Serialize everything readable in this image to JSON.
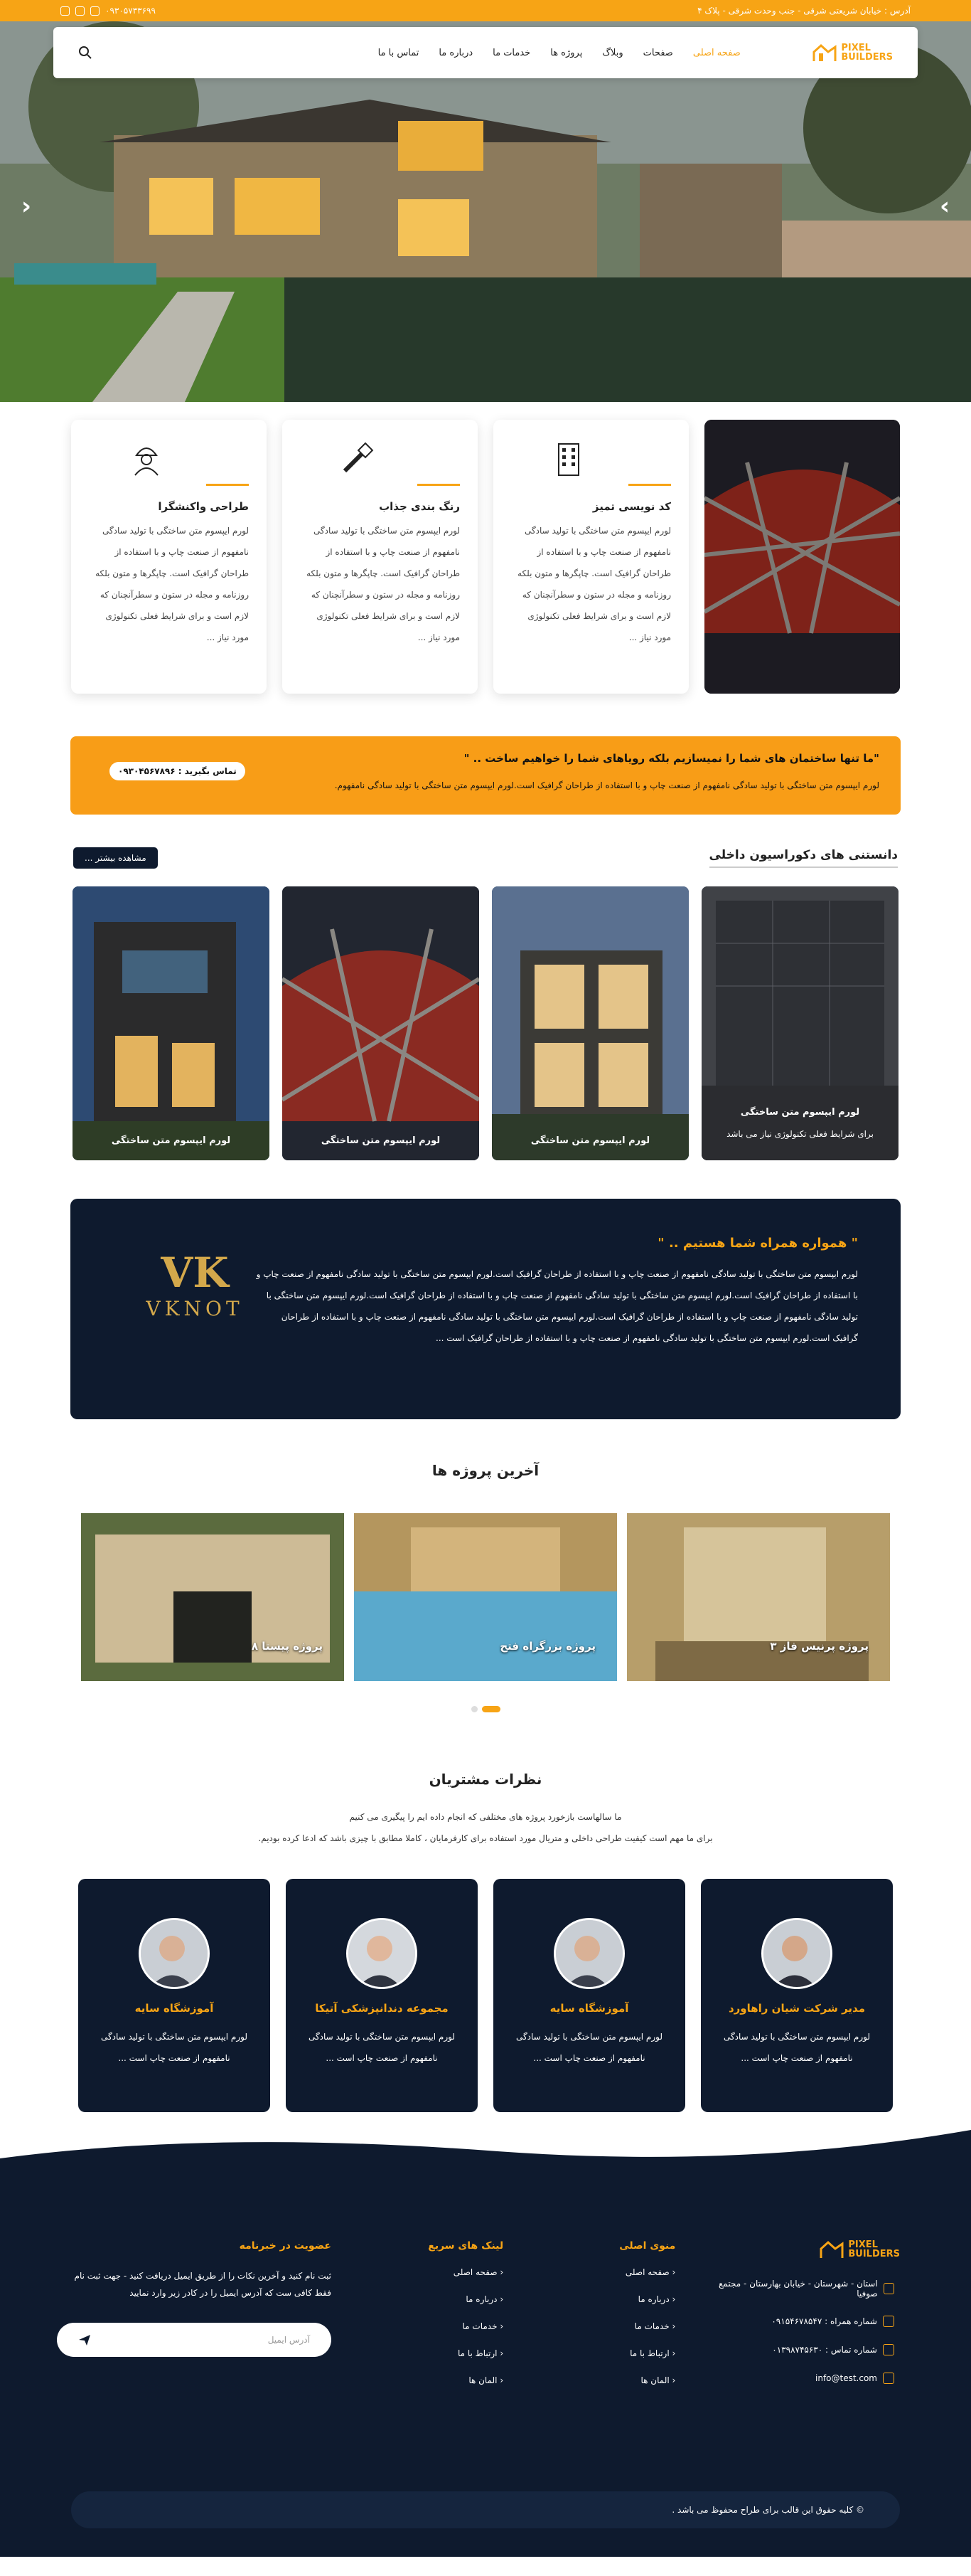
{
  "topbar": {
    "address": "آدرس : خیابان شریعتی شرقی - جنب وحدت شرقی - پلاک ۴",
    "phone": "۰۹۳۰۵۷۳۳۶۹۹",
    "social_icons": [
      "whatsapp-icon",
      "telegram-icon",
      "instagram-icon"
    ]
  },
  "nav": {
    "logo_line1": "PIXEL",
    "logo_line2": "BUILDERS",
    "items": [
      "صفحه اصلی",
      "صفحات",
      "وبلاگ",
      "پروژه ها",
      "خدمات ما",
      "درباره ما",
      "تماس با ما"
    ],
    "active": "صفحه اصلی"
  },
  "features": [
    {
      "title": "کد نویسی تمیز",
      "icon": "building-icon",
      "text": "لورم ایپسوم متن ساختگی با تولید سادگی نامفهوم از صنعت چاپ و با استفاده از طراحان گرافیک است. چاپگرها و متون بلکه روزنامه و مجله در ستون و سطرآنچنان که لازم است و برای شرایط فعلی تکنولوژی مورد نیاز ..."
    },
    {
      "title": "رنگ بندی جذاب",
      "icon": "paint-brush-icon",
      "text": "لورم ایپسوم متن ساختگی با تولید سادگی نامفهوم از صنعت چاپ و با استفاده از طراحان گرافیک است. چاپگرها و متون بلکه روزنامه و مجله در ستون و سطرآنچنان که لازم است و برای شرایط فعلی تکنولوژی مورد نیاز ..."
    },
    {
      "title": "طراحی واکنشگرا",
      "icon": "engineer-icon",
      "text": "لورم ایپسوم متن ساختگی با تولید سادگی نامفهوم از صنعت چاپ و با استفاده از طراحان گرافیک است. چاپگرها و متون بلکه روزنامه و مجله در ستون و سطرآنچنان که لازم است و برای شرایط فعلی تکنولوژی مورد نیاز ..."
    }
  ],
  "cta": {
    "title": "\"ما تنها ساختمان های شما را نمیسازیم بلکه رویاهای شما را خواهیم ساخت .. \"",
    "text": "لورم ایپسوم متن ساختگی با تولید سادگی نامفهوم از صنعت چاپ و با استفاده از طراحان گرافیک است.لورم ایپسوم متن ساختگی با تولید سادگی نامفهوم.",
    "button": "تماس بگیرید : ۰۹۳۰۴۵۶۷۸۹۶"
  },
  "knowledge": {
    "title": "دانستنی های دکوراسیون داخلی",
    "more": "مشاهده بیشتر ...",
    "cards": [
      {
        "caption": "لورم ایپسوم متن ساختگی",
        "sub": "برای شرایط فعلی تکنولوژی نیاز می باشد"
      },
      {
        "caption": "لورم ایپسوم متن ساختگی",
        "sub": ""
      },
      {
        "caption": "لورم ایپسوم متن ساختگی",
        "sub": ""
      },
      {
        "caption": "لورم ایپسوم متن ساختگی",
        "sub": ""
      }
    ]
  },
  "banner": {
    "title": "\" همواره همراه شما هستیم .. \"",
    "text": "لورم ایپسوم متن ساختگی با تولید سادگی نامفهوم از صنعت چاپ و با استفاده از طراحان گرافیک است.لورم ایپسوم متن ساختگی با تولید سادگی نامفهوم از صنعت چاپ و با استفاده از طراحان گرافیک است.لورم ایپسوم متن ساختگی با تولید سادگی نامفهوم از صنعت چاپ و با استفاده از طراحان گرافیک است.لورم ایپسوم متن ساختگی با تولید سادگی نامفهوم از صنعت چاپ و با استفاده از طراحان گرافیک است.لورم ایپسوم متن ساختگی با تولید سادگی نامفهوم از صنعت چاپ و با استفاده از طراحان گرافیک است.لورم ایپسوم متن ساختگی با تولید سادگی نامفهوم از صنعت چاپ و با استفاده از طراحان گرافیک است ...",
    "logo_mono": "VK",
    "logo_word": "VKNOT"
  },
  "projects": {
    "title": "آخرین پروژه ها",
    "items": [
      "پروژه پرنیس فاز ۳",
      "پروژه بزرگراه فتح",
      "پروژه پیستا ۸"
    ]
  },
  "reviews": {
    "title": "نظرات مشتریان",
    "sub1": "ما سالهاست بازخورد پروژه های مختلفی که انجام داده ایم را پیگیری می کنیم",
    "sub2": "برای ما مهم است کیفیت طراحی داخلی و متریال مورد استفاده برای کارفرمایان ، کاملا مطابق با چیزی باشد که ادعا کرده بودیم.",
    "items": [
      {
        "name": "مدیر شرکت شیان راهاورد",
        "text": "لورم ایپسوم متن ساختگی با تولید سادگی نامفهوم از صنعت چاپ است ..."
      },
      {
        "name": "آموزشگاه سایه",
        "text": "لورم ایپسوم متن ساختگی با تولید سادگی نامفهوم از صنعت چاپ است ..."
      },
      {
        "name": "مجموعه دندانپزشکی آتیکا",
        "text": "لورم ایپسوم متن ساختگی با تولید سادگی نامفهوم از صنعت چاپ است ..."
      },
      {
        "name": "آموزشگاه سایه",
        "text": "لورم ایپسوم متن ساختگی با تولید سادگی نامفهوم از صنعت چاپ است ..."
      }
    ]
  },
  "footer": {
    "address": "استان - شهرستان - خیابان بهارستان - مجتمع صوفیا",
    "mobile": "شماره همراه : ۰۹۱۵۴۶۷۸۵۴۷",
    "tel": "شماره تماس : ۰۱۳۹۸۷۴۵۶۳۰",
    "email": "info@test.com",
    "menu_title": "منوی اصلی",
    "menu": [
      "صفحه اصلی",
      "درباره ما",
      "خدمات ما",
      "ارتباط با ما",
      "المان ها"
    ],
    "links_title": "لینک های سریع",
    "links": [
      "صفحه اصلی",
      "درباره ما",
      "خدمات ما",
      "ارتباط با ما",
      "المان ها"
    ],
    "news_title": "عضویت در خبرنامه",
    "news_text": "ثبت نام کنید و آخرین نکات را از طریق ایمیل دریافت کنید - جهت ثبت نام فقط کافی ست که آدرس ایمیل را در کادر زیر وارد نمایید",
    "email_placeholder": "آدرس ایمیل",
    "copyright": "© کلیه حقوق این قالب برای طراح محفوظ می باشد ."
  },
  "colors": {
    "accent": "#f7a415",
    "navy": "#0e1a2e"
  }
}
